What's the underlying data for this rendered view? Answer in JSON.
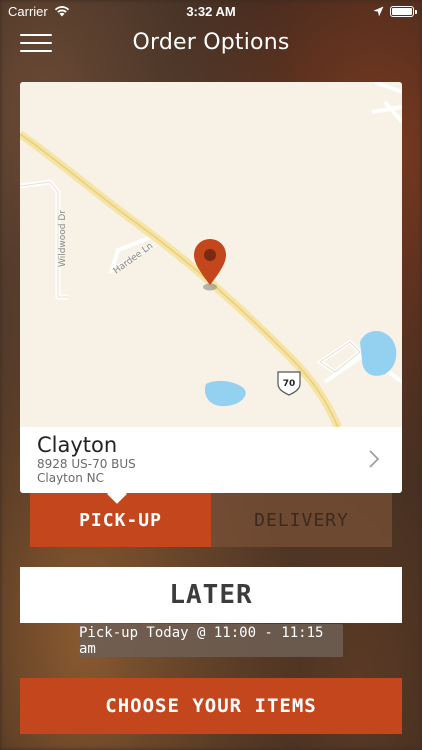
{
  "status_bar": {
    "carrier": "Carrier",
    "time": "3:32 AM"
  },
  "header": {
    "title": "Order Options"
  },
  "map": {
    "street_labels": [
      "Wildwood Dr",
      "Hardee Ln"
    ],
    "highway_shield": "70",
    "pin_color": "#c4461c"
  },
  "location": {
    "name": "Clayton",
    "address_line": "8928 US-70 BUS",
    "city_line": "Clayton NC"
  },
  "order_type": {
    "pickup_label": "PICK-UP",
    "delivery_label": "DELIVERY",
    "selected": "PICK-UP"
  },
  "timing": {
    "later_label": "LATER",
    "pickup_time": "Pick-up Today @ 11:00 - 11:15 am"
  },
  "cta": {
    "choose_label": "CHOOSE YOUR ITEMS"
  },
  "colors": {
    "accent": "#c4461c"
  }
}
